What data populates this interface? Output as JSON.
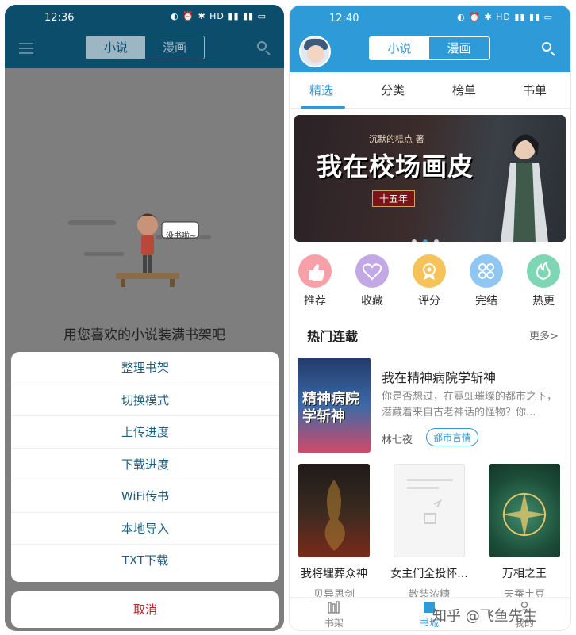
{
  "left": {
    "status_time": "12:36",
    "status_icons": "◐ ⏰ ✱ HD ▮▮ ▮▮ ▭",
    "tabs": {
      "novel": "小说",
      "comic": "漫画"
    },
    "empty_text": "用您喜欢的小说装满书架吧",
    "empty_bubble": "没书啦~",
    "sheet_items": [
      "整理书架",
      "切换模式",
      "上传进度",
      "下载进度",
      "WiFi传书",
      "本地导入",
      "TXT下载"
    ],
    "cancel_label": "取消"
  },
  "right": {
    "status_time": "12:40",
    "status_icons": "◐ ⏰ ✱ HD ▮▮ ▮▮ ▭",
    "tabs": {
      "novel": "小说",
      "comic": "漫画"
    },
    "nav_tabs": [
      "精选",
      "分类",
      "榜单",
      "书单"
    ],
    "banner": {
      "title": "我在校场画皮",
      "subtitle": "沉默的糕点 著",
      "tag": "十五年"
    },
    "quick": [
      {
        "label": "推荐",
        "color": "#f7a0a8",
        "icon": "thumb-up-icon"
      },
      {
        "label": "收藏",
        "color": "#c3a8e6",
        "icon": "heart-icon"
      },
      {
        "label": "评分",
        "color": "#f6c35b",
        "icon": "medal-icon"
      },
      {
        "label": "完结",
        "color": "#8fc6f2",
        "icon": "flower-icon"
      },
      {
        "label": "热更",
        "color": "#7ed6b4",
        "icon": "flame-icon"
      }
    ],
    "section_title": "热门连载",
    "more_label": "更多>",
    "featured": {
      "title": "我在精神病院学斩神",
      "cover_text": "精神病院学斩神",
      "description": "你是否想过，在霓虹璀璨的都市之下，潜藏着来自古老神话的怪物？你...",
      "author": "林七夜",
      "genre": "都市言情"
    },
    "books": [
      {
        "title": "我将埋葬众神",
        "author": "贝异思剑"
      },
      {
        "title": "女主们全投怀...",
        "author": "散装浓糖"
      },
      {
        "title": "万相之王",
        "author": "天蚕土豆"
      }
    ],
    "bottom_nav": [
      "书架",
      "书城",
      "我的"
    ],
    "watermark": "知乎 @飞鱼先生"
  }
}
